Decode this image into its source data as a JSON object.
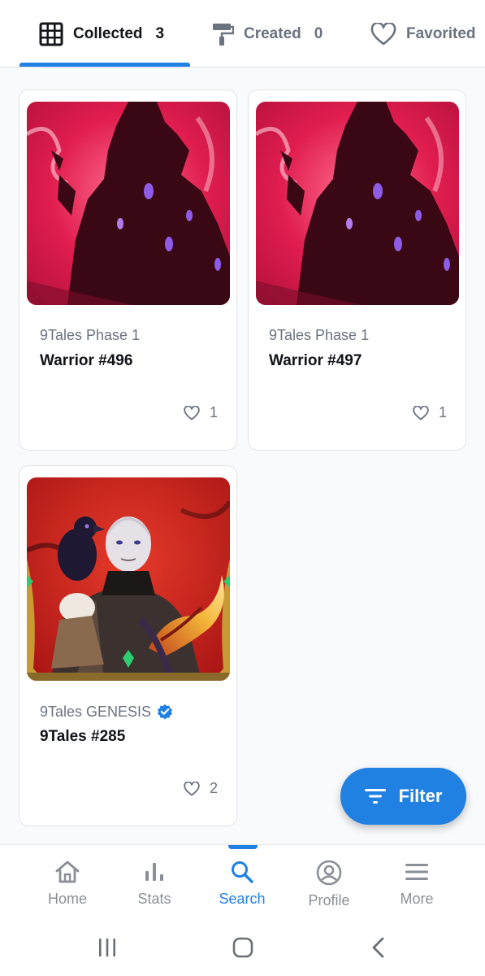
{
  "tabs": [
    {
      "label": "Collected",
      "count": "3",
      "icon": "grid-icon"
    },
    {
      "label": "Created",
      "count": "0",
      "icon": "paint-roller-icon"
    },
    {
      "label": "Favorited",
      "icon": "heart-outline-icon"
    }
  ],
  "cards": [
    {
      "collection": "9Tales Phase 1",
      "name": "Warrior #496",
      "likes": "1",
      "verified": false
    },
    {
      "collection": "9Tales Phase 1",
      "name": "Warrior #497",
      "likes": "1",
      "verified": false
    },
    {
      "collection": "9Tales GENESIS",
      "name": "9Tales #285",
      "likes": "2",
      "verified": true
    }
  ],
  "filter": {
    "label": "Filter",
    "icon": "filter-icon"
  },
  "nav": [
    {
      "label": "Home",
      "icon": "home-icon"
    },
    {
      "label": "Stats",
      "icon": "bar-chart-icon"
    },
    {
      "label": "Search",
      "icon": "search-icon",
      "active": true
    },
    {
      "label": "Profile",
      "icon": "profile-icon"
    },
    {
      "label": "More",
      "icon": "menu-icon"
    }
  ],
  "colors": {
    "accent": "#2081e2",
    "muted": "#6b7280",
    "warrior_bg": "#d8194a",
    "genesis_bg": "#c81f1f"
  }
}
